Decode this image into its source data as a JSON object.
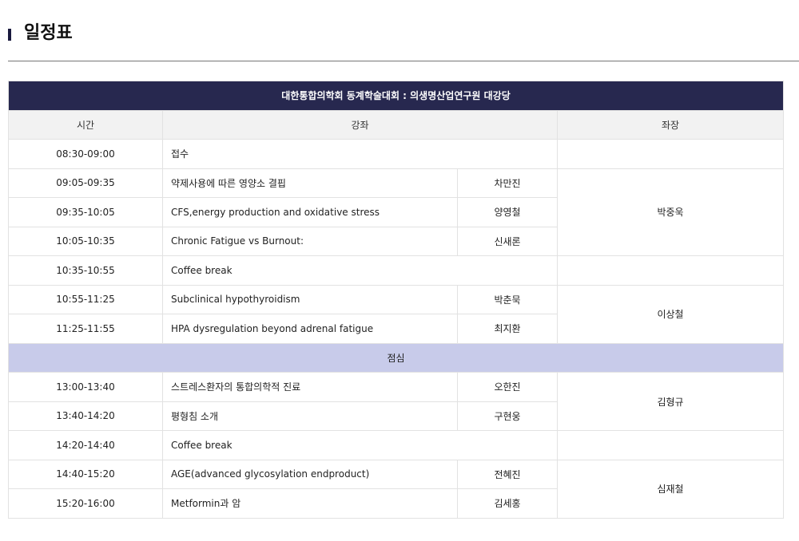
{
  "page_title": "일정표",
  "table": {
    "caption": "대한통합의학회 동계학술대회 : 의생명산업연구원 대강당",
    "columns": {
      "time": "시간",
      "lecture": "강좌",
      "chair": "좌장"
    },
    "rows": [
      {
        "time": "08:30-09:00",
        "lecture": "접수",
        "speaker": ""
      },
      {
        "time": "09:05-09:35",
        "lecture": "약제사용에 따른 영양소 결핍",
        "speaker": "차만진"
      },
      {
        "time": "09:35-10:05",
        "lecture": "CFS,energy production and oxidative stress",
        "speaker": "양영철"
      },
      {
        "time": "10:05-10:35",
        "lecture": "Chronic Fatigue vs Burnout:",
        "speaker": "신새론"
      },
      {
        "time": "10:35-10:55",
        "lecture": "Coffee break",
        "speaker": ""
      },
      {
        "time": "10:55-11:25",
        "lecture": "Subclinical hypothyroidism",
        "speaker": "박춘묵"
      },
      {
        "time": "11:25-11:55",
        "lecture": "HPA dysregulation beyond adrenal fatigue",
        "speaker": "최지환"
      },
      {
        "time": "13:00-13:40",
        "lecture": "스트레스환자의 통합의학적 진료",
        "speaker": "오한진"
      },
      {
        "time": "13:40-14:20",
        "lecture": "평형침 소개",
        "speaker": "구현웅"
      },
      {
        "time": "14:20-14:40",
        "lecture": "Coffee break",
        "speaker": ""
      },
      {
        "time": "14:40-15:20",
        "lecture": "AGE(advanced glycosylation endproduct)",
        "speaker": "전혜진"
      },
      {
        "time": "15:20-16:00",
        "lecture": "Metformin과 암",
        "speaker": "김세홍"
      }
    ],
    "lunch_label": "점심",
    "chairs": [
      "박중욱",
      "이상철",
      "김형규",
      "심재철"
    ]
  },
  "colors": {
    "header_bg": "#27284f",
    "lunch_bg": "#c8cbea",
    "column_header_bg": "#f2f2f2"
  }
}
